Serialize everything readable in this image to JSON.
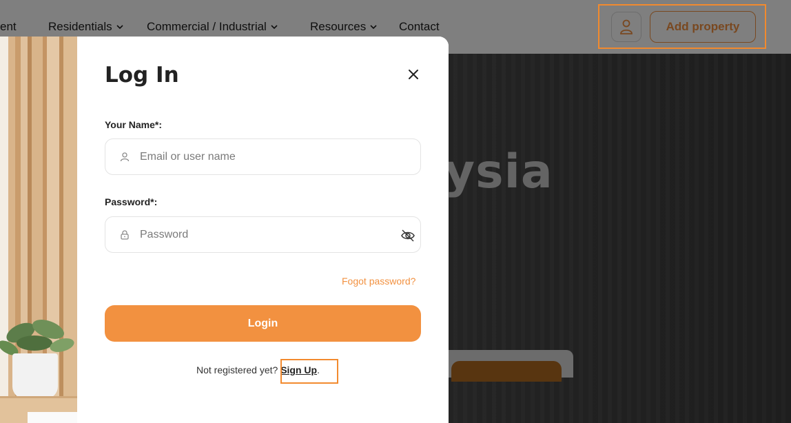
{
  "nav": {
    "items": [
      {
        "label": "ent"
      },
      {
        "label": "Residentials"
      },
      {
        "label": "Commercial / Industrial"
      },
      {
        "label": "Resources"
      },
      {
        "label": "Contact"
      }
    ],
    "user_icon": "user-icon",
    "add_property_label": "Add property"
  },
  "hero": {
    "title_fragment": "aysia"
  },
  "modal": {
    "title": "Log In",
    "close_icon": "close-icon",
    "name_label": "Your Name*:",
    "name_placeholder": "Email or user name",
    "name_value": "",
    "password_label": "Password*:",
    "password_placeholder": "Password",
    "password_value": "",
    "forgot_label": "Fogot password?",
    "login_label": "Login",
    "signup_prompt": "Not registered yet?",
    "signup_link": "Sign Up",
    "signup_suffix": "."
  },
  "colors": {
    "accent": "#f29140",
    "highlight": "#f28a2e",
    "overlay": "rgba(0,0,0,0.5)"
  }
}
